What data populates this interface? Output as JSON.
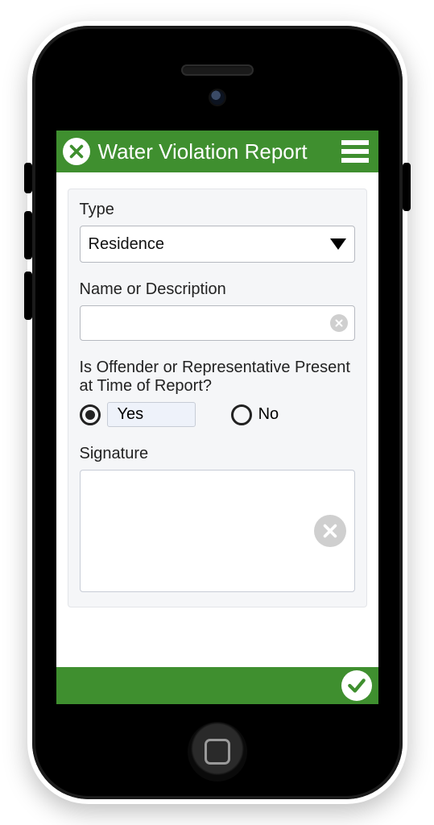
{
  "colors": {
    "brand": "#3f8f2f"
  },
  "header": {
    "title": "Water Violation Report",
    "close_icon": "close-icon",
    "menu_icon": "hamburger-icon"
  },
  "form": {
    "type": {
      "label": "Type",
      "value": "Residence"
    },
    "name_desc": {
      "label": "Name or Description",
      "value": "",
      "placeholder": ""
    },
    "present": {
      "label": "Is Offender or Representative Present at Time of Report?",
      "options": {
        "yes": "Yes",
        "no": "No"
      },
      "selected": "yes"
    },
    "signature": {
      "label": "Signature"
    }
  },
  "footer": {
    "submit_icon": "check-icon"
  }
}
